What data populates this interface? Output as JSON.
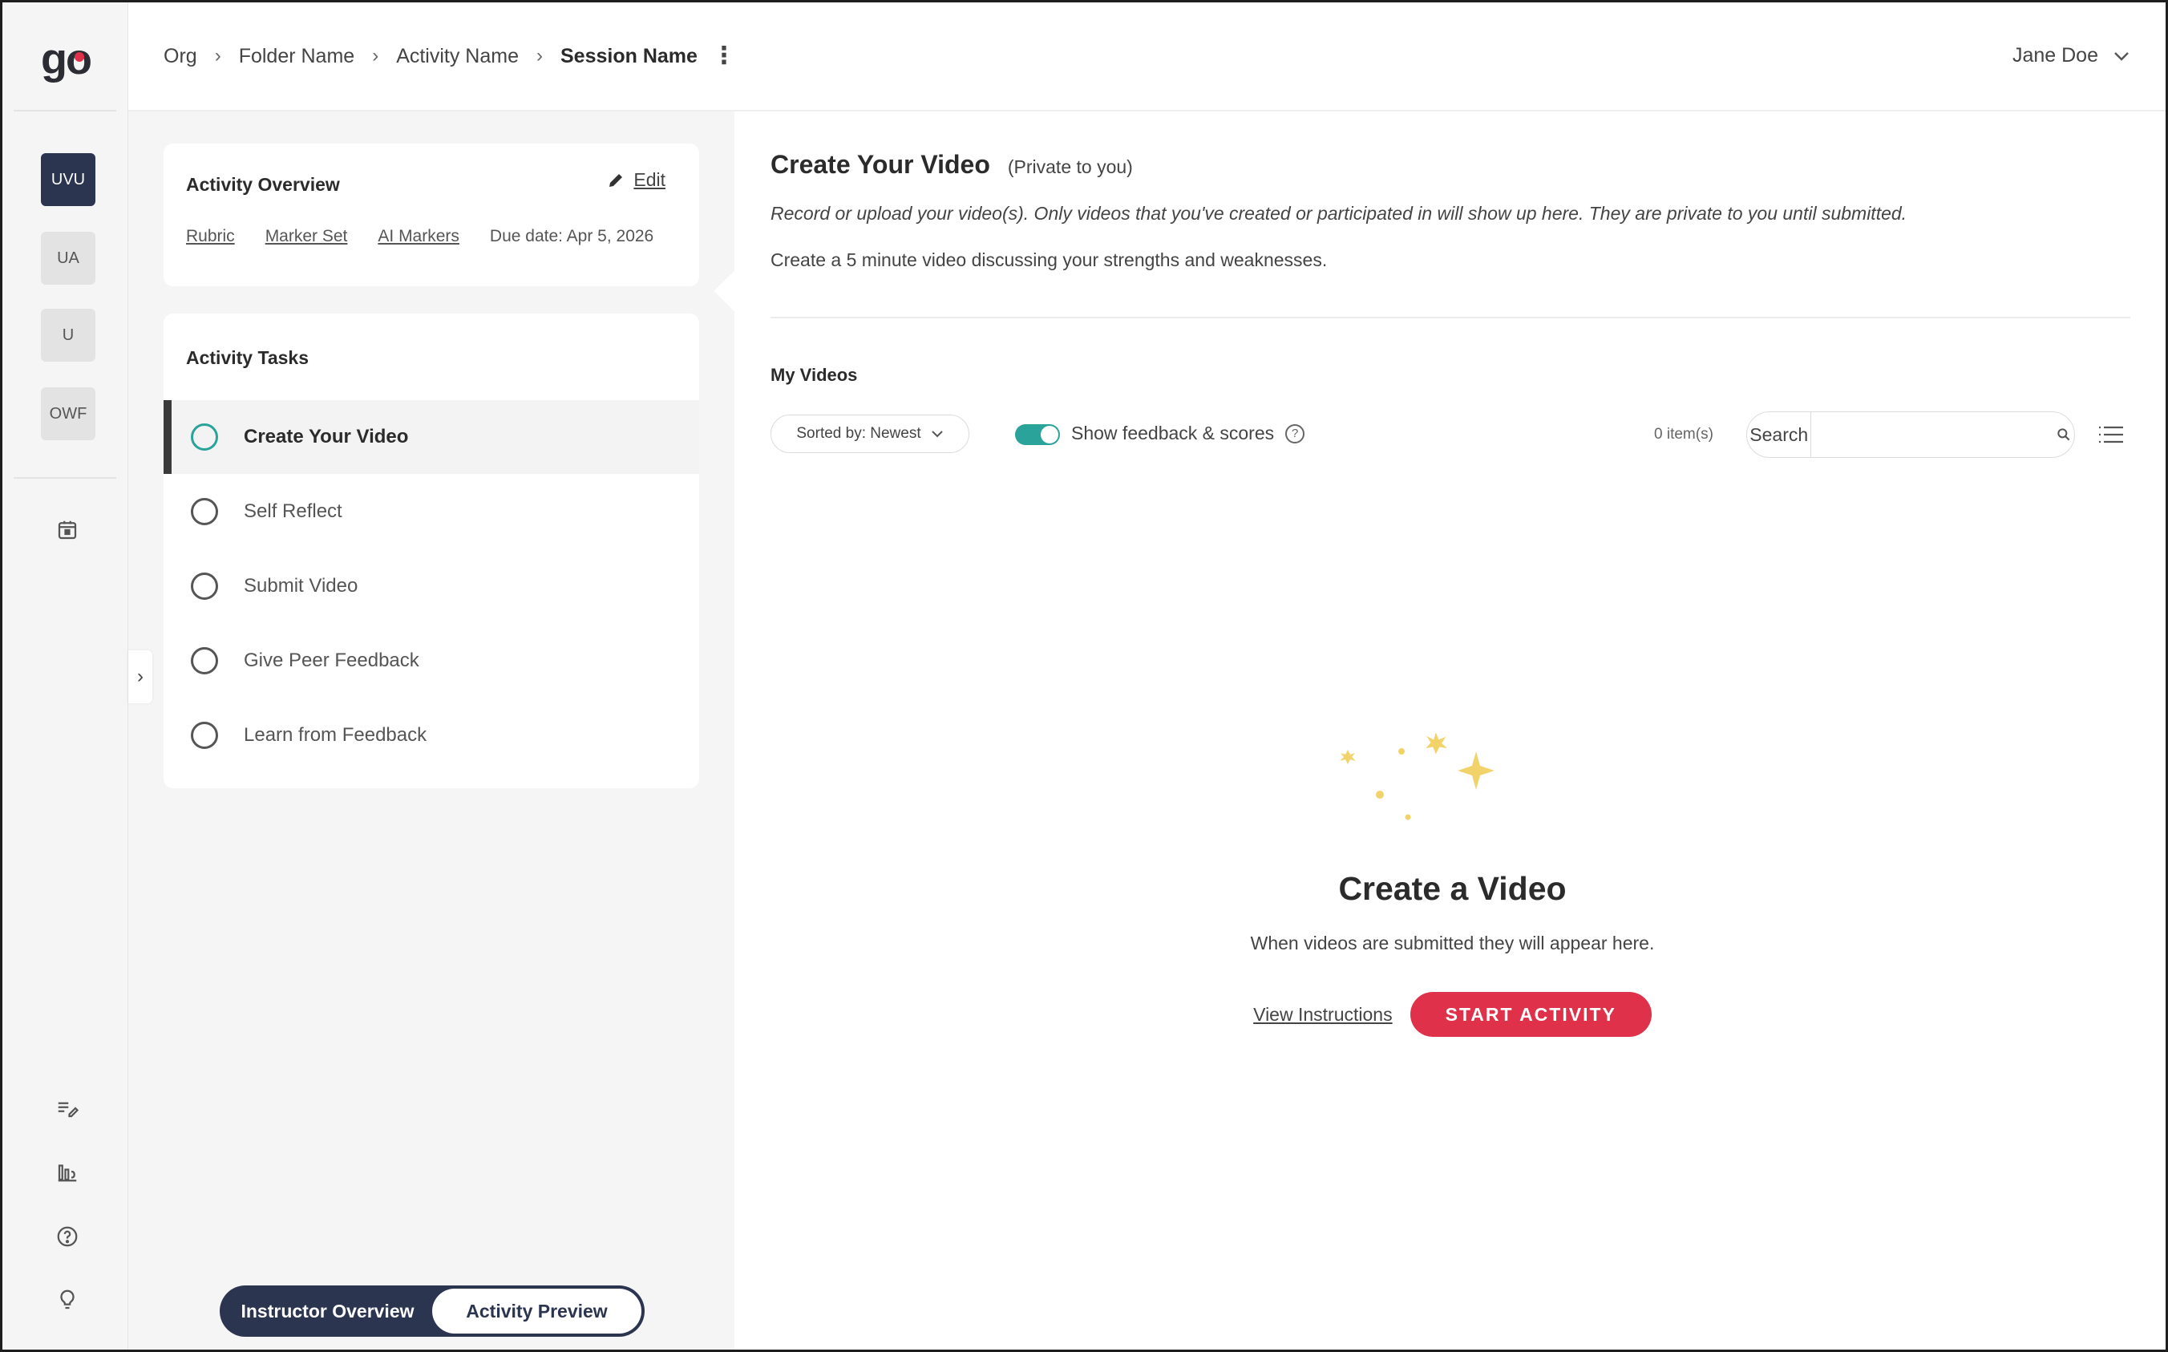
{
  "app": {
    "logo_text": "go",
    "colors": {
      "brand_navy": "#2c3550",
      "accent_red": "#e0314b",
      "accent_teal": "#2aa39a"
    }
  },
  "rail": {
    "orgs": [
      {
        "label": "UVU",
        "active": true
      },
      {
        "label": "UA",
        "active": false
      },
      {
        "label": "U",
        "active": false
      },
      {
        "label": "OWF",
        "active": false
      }
    ],
    "top_icons": [
      "calendar-icon"
    ],
    "bottom_icons": [
      "edit-list-icon",
      "analytics-icon",
      "help-icon",
      "lightbulb-icon"
    ]
  },
  "header": {
    "breadcrumbs": [
      "Org",
      "Folder Name",
      "Activity Name",
      "Session Name"
    ],
    "user_name": "Jane Doe"
  },
  "overview": {
    "title": "Activity Overview",
    "edit_label": "Edit",
    "links": [
      "Rubric",
      "Marker Set",
      "AI Markers"
    ],
    "due_date": "Due date: Apr 5, 2026"
  },
  "tasks": {
    "title": "Activity Tasks",
    "items": [
      {
        "label": "Create Your Video",
        "active": true
      },
      {
        "label": "Self Reflect",
        "active": false
      },
      {
        "label": "Submit Video",
        "active": false
      },
      {
        "label": "Give Peer Feedback",
        "active": false
      },
      {
        "label": "Learn from Feedback",
        "active": false
      }
    ]
  },
  "view_toggle": {
    "options": [
      "Instructor Overview",
      "Activity Preview"
    ],
    "selected": "Activity Preview"
  },
  "main": {
    "title": "Create Your Video",
    "privacy": "(Private to you)",
    "instruction_italic": "Record or upload your video(s). Only videos that you've created or participated in will show up here. They are private to you until submitted.",
    "prompt": "Create a 5 minute video discussing your strengths and weaknesses.",
    "section_title": "My Videos",
    "sort_label": "Sorted by: Newest",
    "toggle_label": "Show feedback & scores",
    "toggle_on": true,
    "item_count": "0 item(s)",
    "search_label": "Search",
    "search_value": "",
    "empty_title": "Create a Video",
    "empty_sub": "When videos are submitted they will appear here.",
    "view_instructions": "View Instructions",
    "start_button": "START ACTIVITY"
  }
}
